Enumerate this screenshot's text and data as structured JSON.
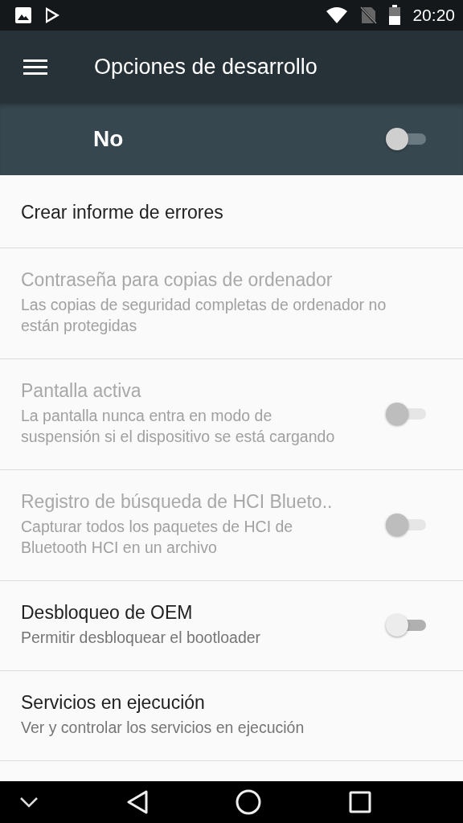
{
  "status_bar": {
    "time": "20:20"
  },
  "toolbar": {
    "title": "Opciones de desarrollo"
  },
  "master_switch": {
    "label": "No",
    "on": false
  },
  "items": [
    {
      "kind": "simple",
      "title": "Crear informe de errores",
      "disabled": false
    },
    {
      "kind": "simple",
      "title": "Contraseña para copias de ordenador",
      "summary": "Las copias de seguridad completas de ordenador no están protegidas",
      "disabled": true
    },
    {
      "kind": "switch",
      "title": "Pantalla activa",
      "summary": "La pantalla nunca entra en modo de suspensión si el dispositivo se está cargando",
      "disabled": true,
      "on": false
    },
    {
      "kind": "switch",
      "title": "Registro de búsqueda de HCI Blueto..",
      "summary": "Capturar todos los paquetes de HCI de Bluetooth HCI en un archivo",
      "disabled": true,
      "on": false
    },
    {
      "kind": "switch",
      "title": "Desbloqueo de OEM",
      "summary": "Permitir desbloquear el bootloader",
      "disabled": false,
      "on": false
    },
    {
      "kind": "simple",
      "title": "Servicios en ejecución",
      "summary": "Ver y controlar los servicios en ejecución",
      "disabled": false
    }
  ]
}
